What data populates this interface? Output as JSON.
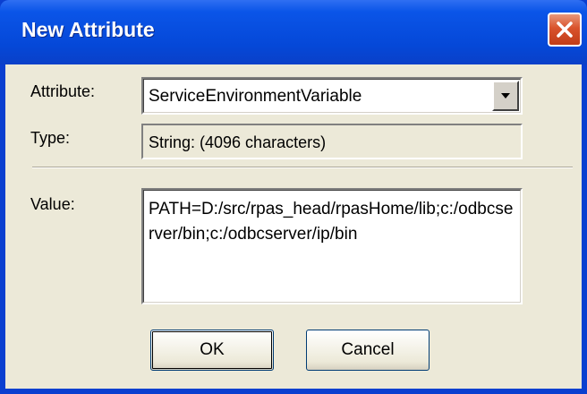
{
  "window": {
    "title": "New Attribute"
  },
  "attribute": {
    "label": "Attribute:",
    "selected": "ServiceEnvironmentVariable"
  },
  "type": {
    "label": "Type:",
    "value": "String: (4096 characters)"
  },
  "value": {
    "label": "Value:",
    "text": "PATH=D:/src/rpas_head/rpasHome/lib;c:/odbcserver/bin;c:/odbcserver/ip/bin"
  },
  "buttons": {
    "ok": "OK",
    "cancel": "Cancel"
  },
  "icons": {
    "close": "close-icon",
    "dropdown": "chevron-down-icon"
  }
}
